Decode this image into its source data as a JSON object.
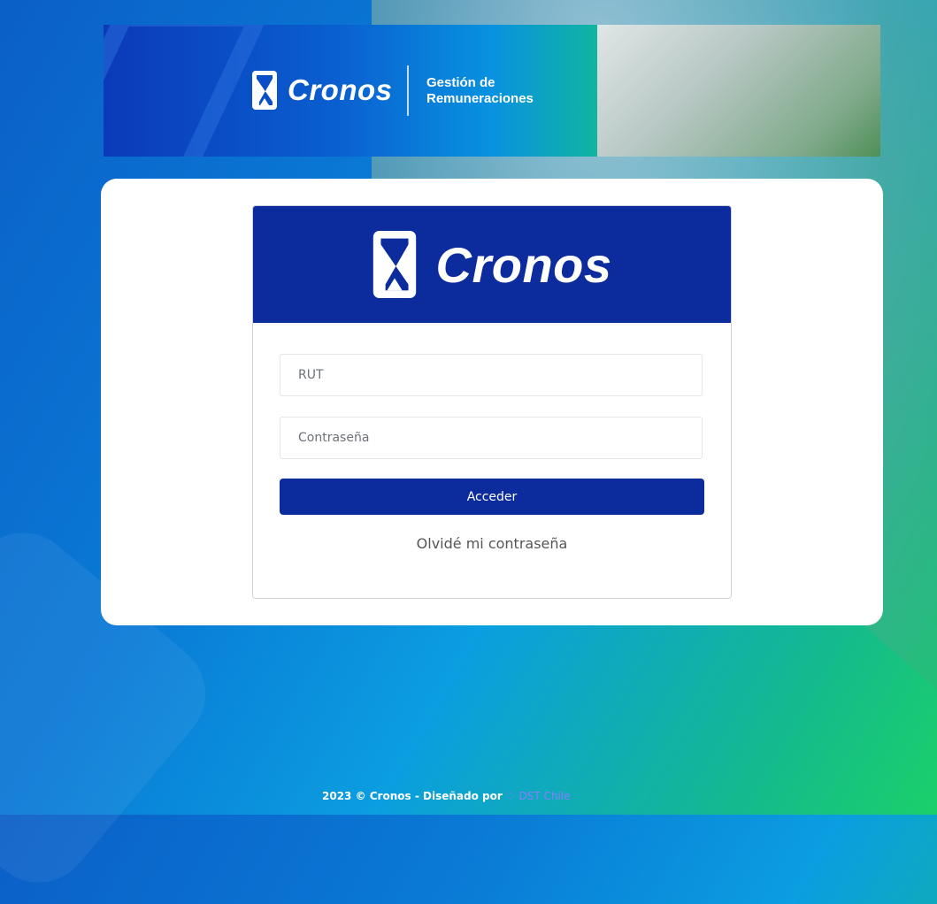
{
  "banner": {
    "logo_text": "Cronos",
    "subtitle_line1": "Gestión de",
    "subtitle_line2": "Remuneraciones"
  },
  "login": {
    "logo_text": "Cronos",
    "rut_placeholder": "RUT",
    "password_placeholder": "Contraseña",
    "submit_label": "Acceder",
    "forgot_label": "Olvidé mi contraseña"
  },
  "footer": {
    "text": "2023 © Cronos - Diseñado por",
    "brand": "DST Chile"
  },
  "colors": {
    "primary": "#0c2c9e",
    "accent_green": "#1bd06a"
  }
}
